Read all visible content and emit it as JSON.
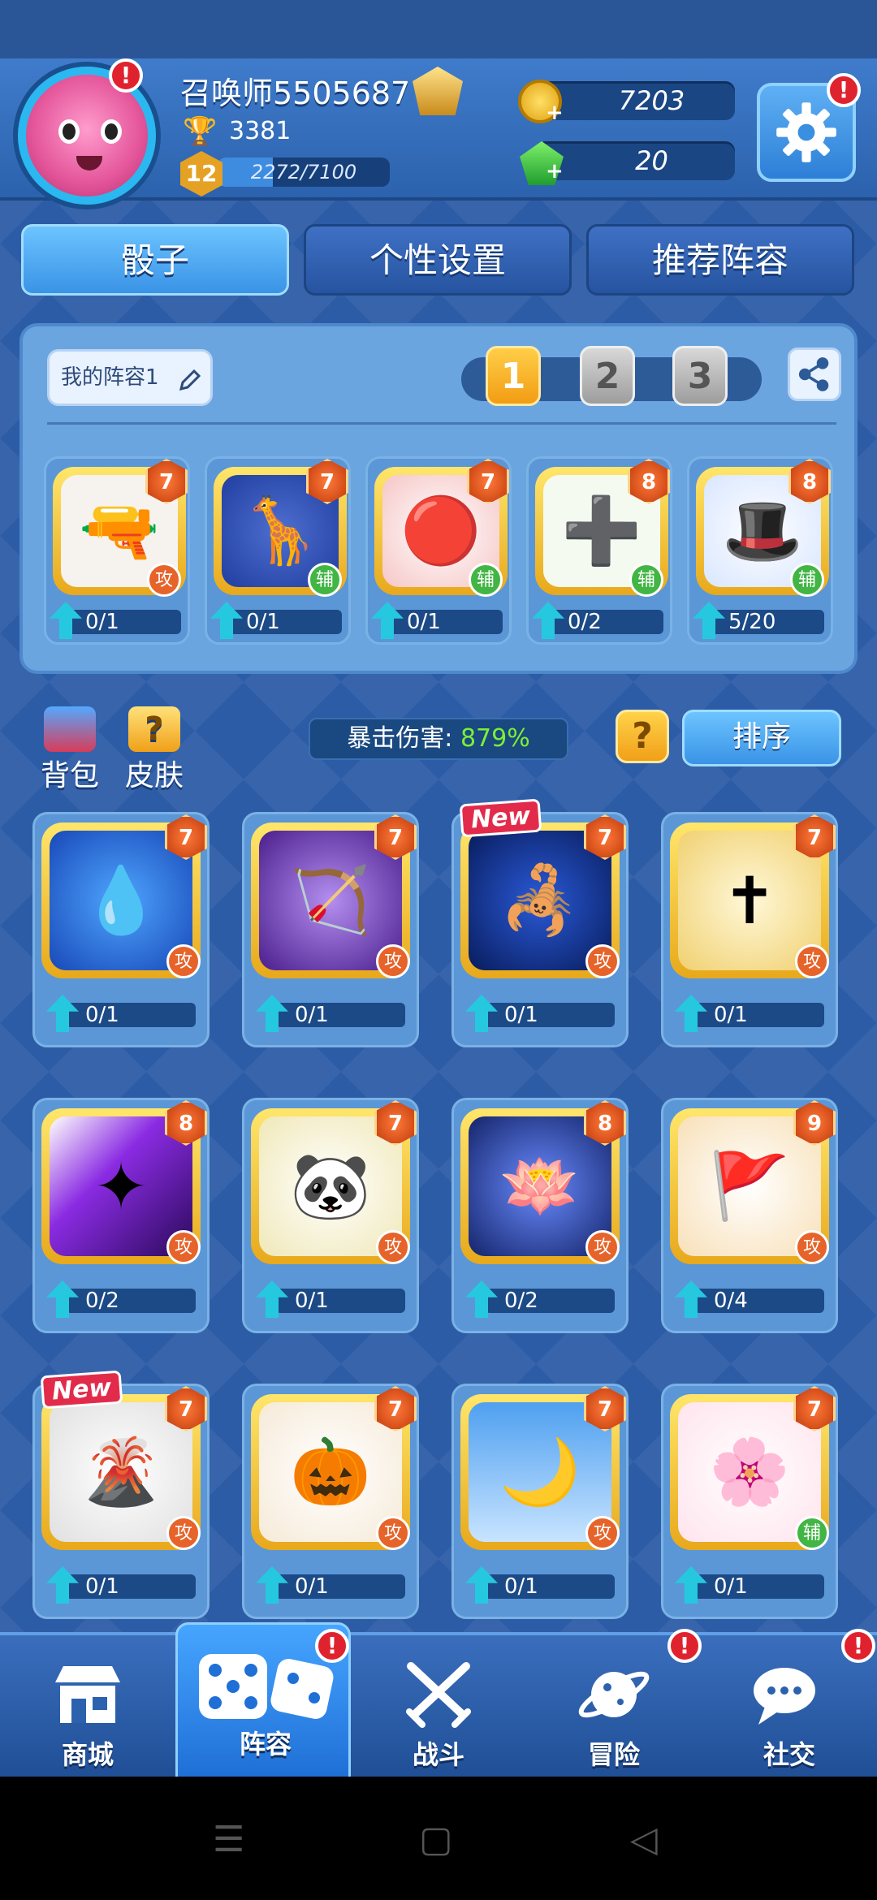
{
  "header": {
    "player_name": "召唤师5505687",
    "trophies": "3381",
    "level": "12",
    "xp_text": "2272/7100",
    "xp_fraction": 0.32,
    "gold": "7203",
    "gems": "20",
    "alert": "!"
  },
  "tabs": [
    {
      "label": "骰子"
    },
    {
      "label": "个性设置"
    },
    {
      "label": "推荐阵容"
    }
  ],
  "deck": {
    "name": "我的阵容1",
    "slots": [
      "1",
      "2",
      "3"
    ],
    "cards": [
      {
        "level": "7",
        "role": "攻",
        "progress": "0/1",
        "icon": "gun-icon"
      },
      {
        "level": "7",
        "role": "辅",
        "progress": "0/1",
        "icon": "giraffe-icon"
      },
      {
        "level": "7",
        "role": "辅",
        "progress": "0/1",
        "icon": "red-button-icon"
      },
      {
        "level": "8",
        "role": "辅",
        "progress": "0/2",
        "icon": "green-cross-icon"
      },
      {
        "level": "8",
        "role": "辅",
        "progress": "5/20",
        "icon": "magic-hat-icon"
      }
    ]
  },
  "toolbar": {
    "bag": "背包",
    "skin": "皮肤",
    "crit_label": "暴击伤害:",
    "crit_value": "879%",
    "help": "?",
    "sort": "排序"
  },
  "collection": [
    {
      "level": "7",
      "role": "攻",
      "progress": "0/1",
      "icon": "aquarius-icon",
      "new": ""
    },
    {
      "level": "7",
      "role": "攻",
      "progress": "0/1",
      "icon": "archer-icon",
      "new": ""
    },
    {
      "level": "7",
      "role": "攻",
      "progress": "0/1",
      "icon": "scorpion-icon",
      "new": "New"
    },
    {
      "level": "7",
      "role": "攻",
      "progress": "0/1",
      "icon": "holy-cross-icon",
      "new": ""
    },
    {
      "level": "8",
      "role": "攻",
      "progress": "0/2",
      "icon": "purple-light-icon",
      "new": ""
    },
    {
      "level": "7",
      "role": "攻",
      "progress": "0/1",
      "icon": "panda-icon",
      "new": ""
    },
    {
      "level": "8",
      "role": "攻",
      "progress": "0/2",
      "icon": "lotus-icon",
      "new": ""
    },
    {
      "level": "9",
      "role": "攻",
      "progress": "0/4",
      "icon": "banner-icon",
      "new": ""
    },
    {
      "level": "7",
      "role": "攻",
      "progress": "0/1",
      "icon": "volcano-icon",
      "new": "New"
    },
    {
      "level": "7",
      "role": "攻",
      "progress": "0/1",
      "icon": "pumpkin-icon",
      "new": ""
    },
    {
      "level": "7",
      "role": "攻",
      "progress": "0/1",
      "icon": "moon-lady-icon",
      "new": ""
    },
    {
      "level": "7",
      "role": "辅",
      "progress": "0/1",
      "icon": "sakura-icon",
      "new": ""
    }
  ],
  "nav": [
    {
      "label": "商城",
      "icon": "shop-icon"
    },
    {
      "label": "阵容",
      "icon": "dice-icon"
    },
    {
      "label": "战斗",
      "icon": "swords-icon"
    },
    {
      "label": "冒险",
      "icon": "planet-icon"
    },
    {
      "label": "社交",
      "icon": "chat-icon"
    }
  ]
}
